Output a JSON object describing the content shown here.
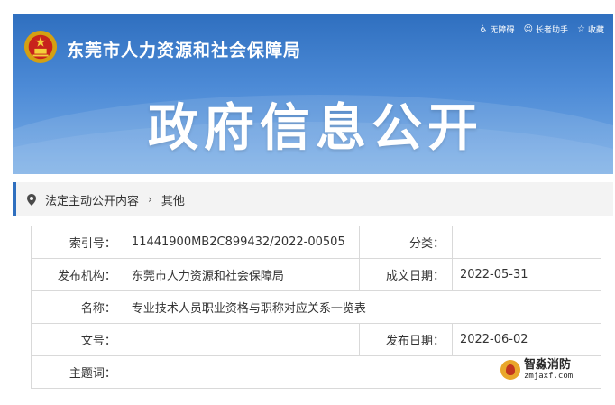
{
  "header": {
    "org_name": "东莞市人力资源和社会保障局",
    "title": "政府信息公开",
    "toolbar": [
      {
        "icon": "accessibility-icon",
        "label": "无障碍"
      },
      {
        "icon": "elder-helper-icon",
        "label": "长者助手"
      },
      {
        "icon": "star-icon",
        "label": "收藏"
      }
    ]
  },
  "breadcrumb": {
    "items": [
      "法定主动公开内容",
      "其他"
    ]
  },
  "info": {
    "index_label": "索引号：",
    "index_value": "11441900MB2C899432/2022-00505",
    "category_label": "分类：",
    "category_value": "",
    "issuer_label": "发布机构：",
    "issuer_value": "东莞市人力资源和社会保障局",
    "written_date_label": "成文日期：",
    "written_date_value": "2022-05-31",
    "name_label": "名称：",
    "name_value": "专业技术人员职业资格与职称对应关系一览表",
    "doc_no_label": "文号：",
    "doc_no_value": "",
    "publish_date_label": "发布日期：",
    "publish_date_value": "2022-06-02",
    "subject_label": "主题词：",
    "subject_value": ""
  },
  "watermark": {
    "name": "智淼消防",
    "domain": "zmjaxf.com"
  },
  "colors": {
    "banner": "#4c8ad6",
    "accent": "#2f6fbf",
    "border": "#d9d9d9"
  }
}
